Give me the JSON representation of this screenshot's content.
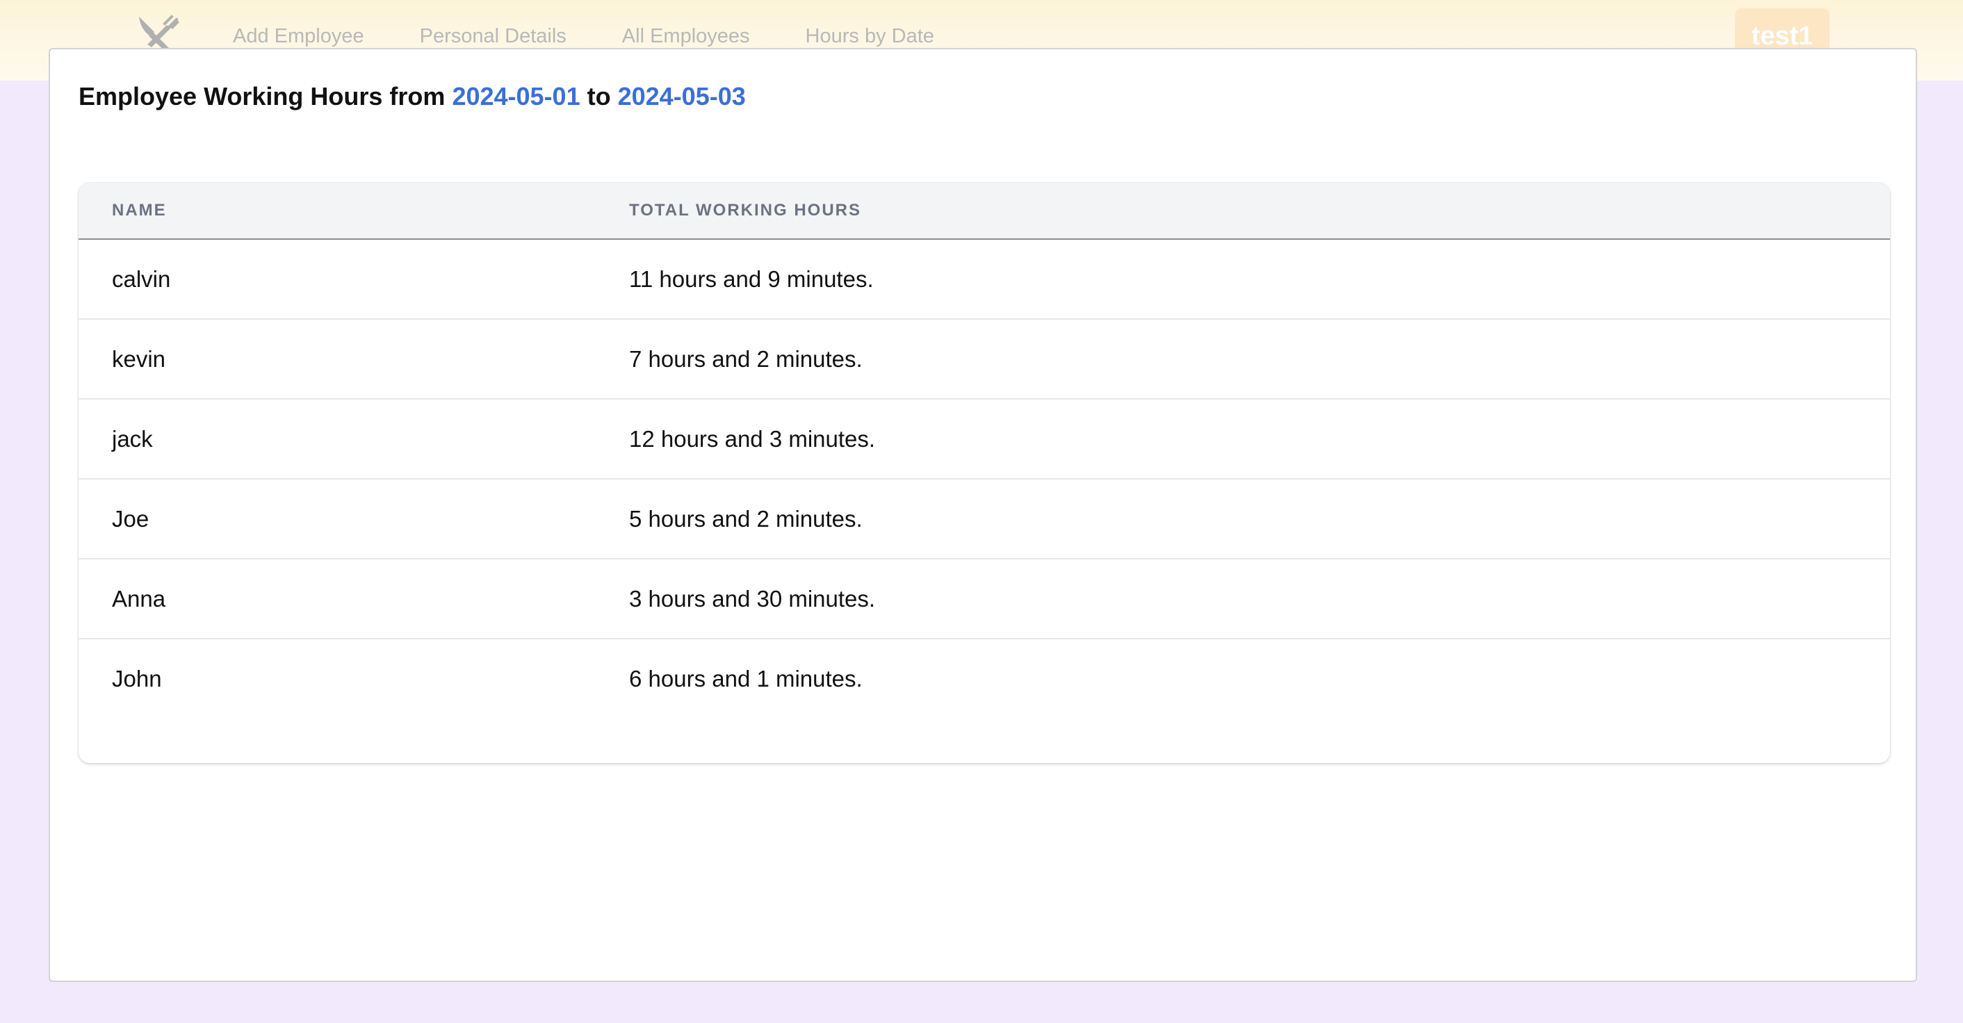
{
  "header": {
    "logo_icon": "utensils-icon",
    "nav": [
      {
        "label": "Add Employee"
      },
      {
        "label": "Personal Details"
      },
      {
        "label": "All Employees"
      },
      {
        "label": "Hours by Date"
      }
    ],
    "user_label": "test1"
  },
  "main": {
    "title_prefix": "Employee Working Hours from",
    "start_date": "2024-05-01",
    "title_mid": "to",
    "end_date": "2024-05-03",
    "table": {
      "columns": [
        "NAME",
        "TOTAL WORKING HOURS"
      ],
      "rows": [
        {
          "name": "calvin",
          "hours": "11 hours and 9 minutes."
        },
        {
          "name": "kevin",
          "hours": "7 hours and 2 minutes."
        },
        {
          "name": "jack",
          "hours": "12 hours and 3 minutes."
        },
        {
          "name": "Joe",
          "hours": "5 hours and 2 minutes."
        },
        {
          "name": "Anna",
          "hours": "3 hours and 30 minutes."
        },
        {
          "name": "John",
          "hours": "6 hours and 1 minutes."
        }
      ]
    }
  },
  "colors": {
    "page_background": "#f2e9fc",
    "header_background": "#fdf3d8",
    "date_accent": "#3b6fd6",
    "user_badge": "#fce6c4"
  }
}
